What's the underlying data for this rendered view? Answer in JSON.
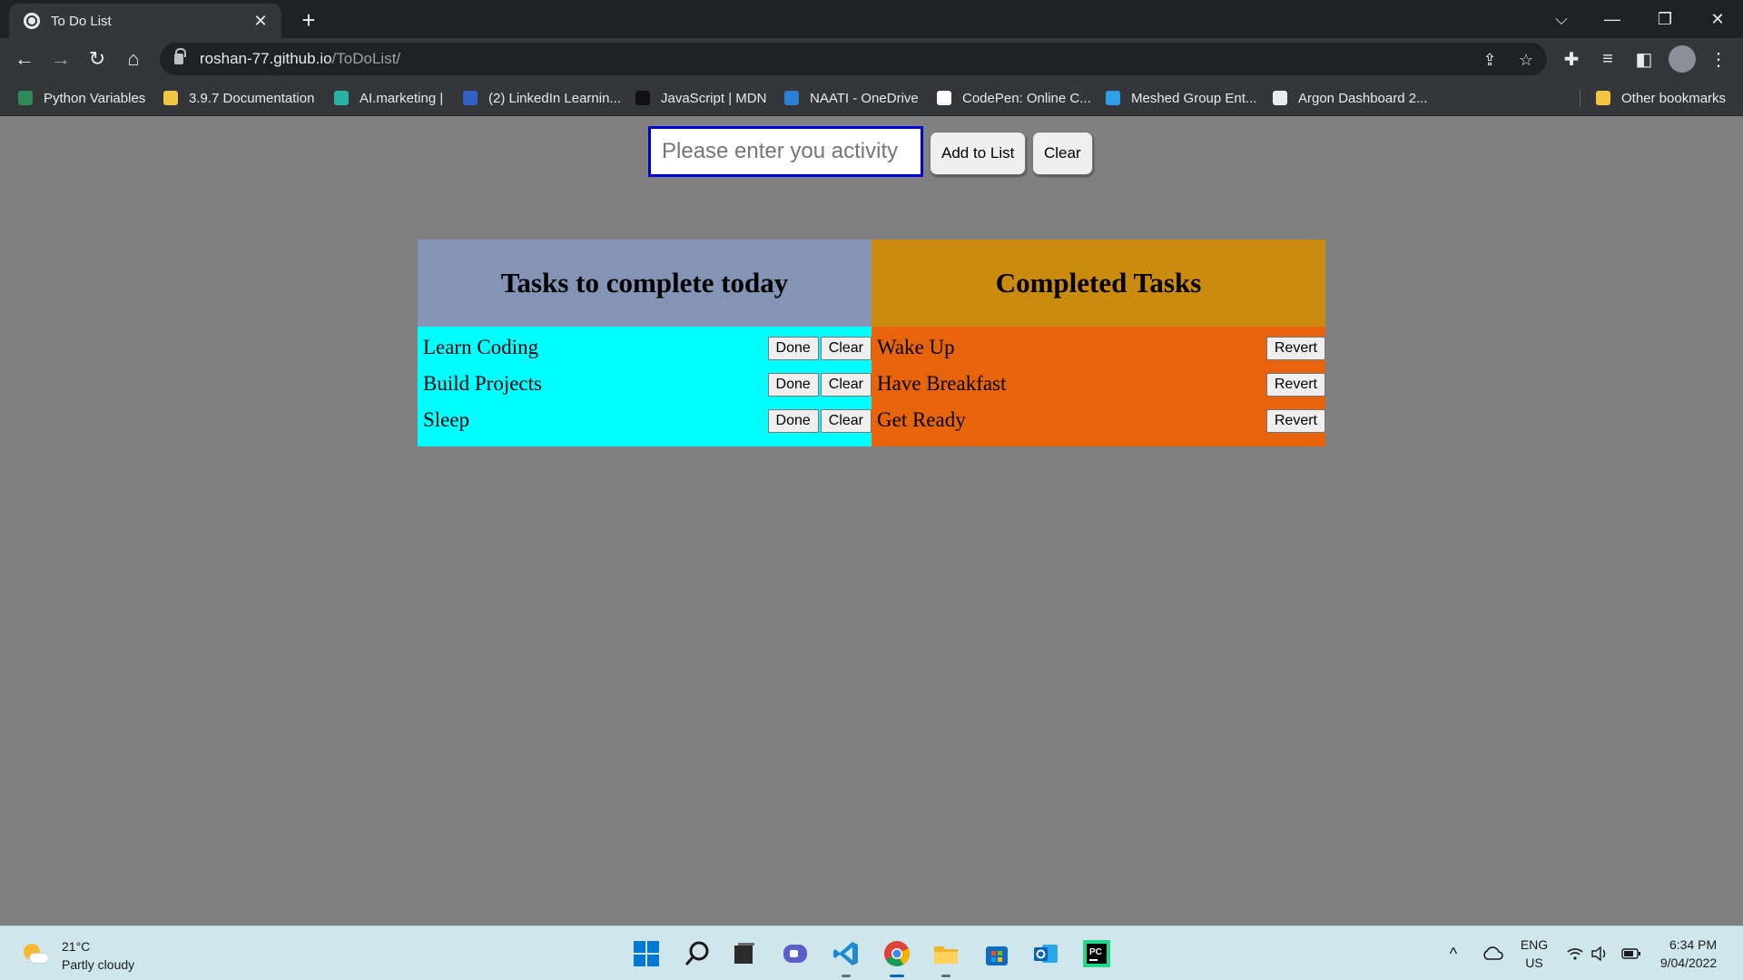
{
  "browser": {
    "tab_title": "To Do List",
    "tab_close": "✕",
    "new_tab": "+",
    "url_host": "roshan-77.github.io",
    "url_path": "/ToDoList/",
    "window_controls": {
      "dropdown": "⌵",
      "minimize": "—",
      "restore": "❐",
      "close": "✕"
    },
    "nav": {
      "back": "←",
      "forward": "→",
      "reload": "↻",
      "home": "⌂"
    },
    "bookmarks": [
      {
        "label": "Python Variables",
        "color": "#2e8b57"
      },
      {
        "label": "3.9.7 Documentation",
        "color": "#f2c744"
      },
      {
        "label": "AI.marketing |",
        "color": "#26b3a4"
      },
      {
        "label": "(2) LinkedIn Learnin...",
        "color": "#2f62c4"
      },
      {
        "label": "JavaScript | MDN",
        "color": "#111111"
      },
      {
        "label": "NAATI - OneDrive",
        "color": "#2a7fd4"
      },
      {
        "label": "CodePen: Online C...",
        "color": "#ffffff"
      },
      {
        "label": "Meshed Group Ent...",
        "color": "#2fa0e6"
      },
      {
        "label": "Argon Dashboard 2...",
        "color": "#e8eaed"
      }
    ],
    "other_bookmarks": "Other bookmarks"
  },
  "page": {
    "input_placeholder": "Please enter you activity",
    "add_button": "Add to List",
    "clear_button": "Clear",
    "todo": {
      "title": "Tasks to complete today",
      "items": [
        "Learn Coding",
        "Build Projects",
        "Sleep"
      ],
      "done_label": "Done",
      "clear_label": "Clear",
      "color_header": "#8394b5",
      "color_body": "#00ffff"
    },
    "completed": {
      "title": "Completed Tasks",
      "items": [
        "Wake Up",
        "Have Breakfast",
        "Get Ready"
      ],
      "revert_label": "Revert",
      "color_header": "#ca8b0f",
      "color_body": "#e8640b"
    }
  },
  "taskbar": {
    "weather_temp": "21°C",
    "weather_desc": "Partly cloudy",
    "apps": [
      "start-icon",
      "search-icon",
      "task-view-icon",
      "teams-chat-icon",
      "vscode-icon",
      "chrome-icon",
      "file-explorer-icon",
      "microsoft-store-icon",
      "outlook-icon",
      "pycharm-icon"
    ],
    "lang_top": "ENG",
    "lang_bottom": "US",
    "time": "6:34 PM",
    "date": "9/04/2022"
  }
}
